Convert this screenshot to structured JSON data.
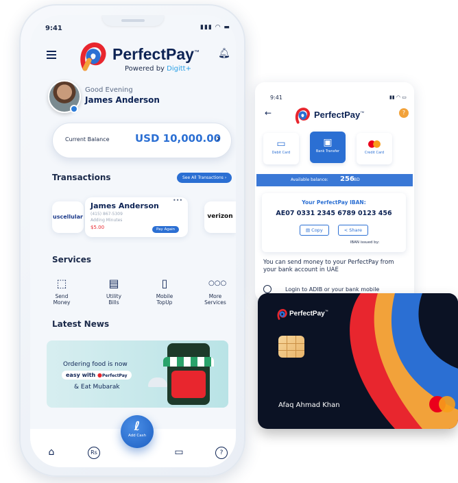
{
  "phone1": {
    "status": {
      "time": "9:41",
      "icons": "signal-wifi-battery"
    },
    "header": {
      "menu_icon": "hamburger-icon",
      "brand": "PerfectPay",
      "tm": "™",
      "powered": "Powered by ",
      "powered_brand": "Digitt+",
      "bell_icon": "bell-icon"
    },
    "greeting": {
      "salutation": "Good Evening",
      "name": "James Anderson"
    },
    "balance": {
      "label": "Current Balance",
      "amount": "USD 10,000.00",
      "chevron": "›"
    },
    "transactions": {
      "title": "Transactions",
      "see_all": "See All Transactions",
      "item": {
        "merchant_logo": "uscellular",
        "name": "James Anderson",
        "phone": "(415) 867-5309",
        "desc": "Adding Minutes",
        "amount": "$5.00",
        "action": "Pay Again",
        "more": "•••"
      },
      "next_logo": "verizon"
    },
    "services": {
      "title": "Services",
      "items": [
        {
          "label1": "Send",
          "label2": "Money",
          "icon": "send-money-icon"
        },
        {
          "label1": "Utility",
          "label2": "Bills",
          "icon": "utility-bills-icon"
        },
        {
          "label1": "Mobile",
          "label2": "TopUp",
          "icon": "mobile-topup-icon"
        },
        {
          "label1": "More",
          "label2": "Services",
          "icon": "more-icon"
        }
      ]
    },
    "news": {
      "title": "Latest News",
      "line1": "Ordering food is now",
      "line2": "easy with",
      "line2_brand": "PerfectPay",
      "line3": "& Eat Mubarak"
    },
    "bottom_nav": {
      "fab_label": "Add Cash",
      "home_icon": "home-icon",
      "rs_icon": "rupee-icon",
      "card_icon": "card-icon",
      "help_icon": "help-icon",
      "rs_text": "Rs",
      "help_text": "?"
    }
  },
  "phone2": {
    "status": {
      "time": "9:41"
    },
    "brand": "PerfectPay",
    "tm": "™",
    "help": "?",
    "tiles": [
      {
        "label": "Debit Card",
        "icon": "debit-card-icon"
      },
      {
        "label": "Bank Transfer",
        "icon": "bank-transfer-icon"
      },
      {
        "label": "Credit Card",
        "icon": "credit-card-icon"
      }
    ],
    "available": {
      "label": "Available balance:",
      "amount": "256",
      "unit": "BD"
    },
    "iban": {
      "title": "Your PerfectPay IBAN:",
      "number": "AE07 0331 2345 6789 0123 456",
      "copy": "Copy",
      "share": "Share",
      "issued": "IBAN issued by:"
    },
    "info": "You can send money to your PerfectPay from your bank account in UAE",
    "step": "Login to ADIB or your bank mobile"
  },
  "card": {
    "brand": "PerfectPay",
    "tm": "™",
    "holder": "Afaq Ahmad Khan"
  },
  "colors": {
    "brand_blue": "#0d2354",
    "accent": "#2b6fd3",
    "red": "#e8262e",
    "orange": "#f2a23a"
  }
}
